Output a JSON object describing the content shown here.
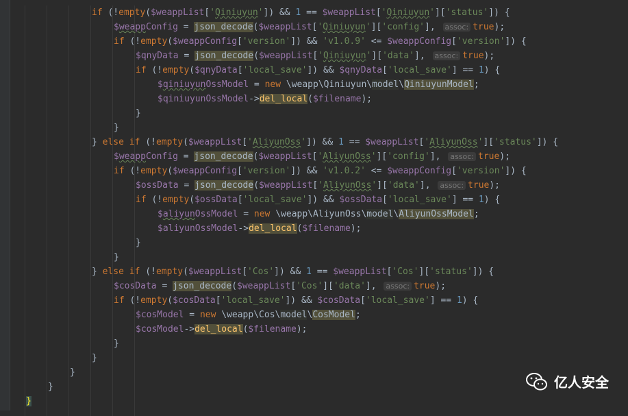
{
  "editor": {
    "lines": [
      "if (!empty($weappList['Qiniuyun']) && 1 == $weappList['Qiniuyun']['status']) {",
      "$weappConfig = json_decode($weappList['Qiniuyun']['config'], assoc: true);",
      "if (!empty($weappConfig['version']) && 'v1.0.9' <= $weappConfig['version']) {",
      "$qnyData = json_decode($weappList['Qiniuyun']['data'], assoc: true);",
      "if (!empty($qnyData['local_save']) && $qnyData['local_save'] == 1) {",
      "$qiniuyunOssModel = new \\weapp\\Qiniuyun\\model\\QiniuyunModel;",
      "$qiniuyunOssModel->del_local($filename);",
      "}",
      "}",
      "} else if (!empty($weappList['AliyunOss']) && 1 == $weappList['AliyunOss']['status']) {",
      "$weappConfig = json_decode($weappList['AliyunOss']['config'], assoc: true);",
      "if (!empty($weappConfig['version']) && 'v1.0.2' <= $weappConfig['version']) {",
      "$ossData = json_decode($weappList['AliyunOss']['data'], assoc: true);",
      "if (!empty($ossData['local_save']) && $ossData['local_save'] == 1) {",
      "$aliyunOssModel = new \\weapp\\AliyunOss\\model\\AliyunOssModel;",
      "$aliyunOssModel->del_local($filename);",
      "}",
      "}",
      "} else if (!empty($weappList['Cos']) && 1 == $weappList['Cos']['status']) {",
      "$cosData = json_decode($weappList['Cos']['data'], assoc: true);",
      "if (!empty($cosData['local_save']) && $cosData['local_save'] == 1) {",
      "$cosModel = new \\weapp\\Cos\\model\\CosModel;",
      "$cosModel->del_local($filename);",
      "}",
      "}",
      "}",
      "}",
      "}"
    ]
  },
  "watermark": {
    "text": "亿人安全"
  }
}
